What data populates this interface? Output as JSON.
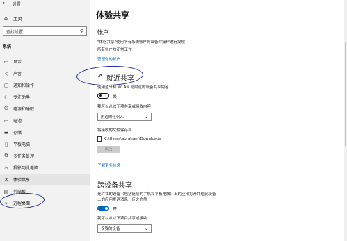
{
  "window": {
    "title": "设置",
    "back_icon": "back-arrow-icon"
  },
  "sidebar": {
    "home_label": "主页",
    "search_placeholder": "查找设置",
    "section_label": "系统",
    "items": [
      {
        "label": "显示",
        "icon": "display-icon"
      },
      {
        "label": "声音",
        "icon": "speaker-icon"
      },
      {
        "label": "通知和操作",
        "icon": "notification-icon"
      },
      {
        "label": "专注助手",
        "icon": "moon-icon"
      },
      {
        "label": "电源和睡眠",
        "icon": "power-icon"
      },
      {
        "label": "电池",
        "icon": "battery-icon"
      },
      {
        "label": "存储",
        "icon": "storage-icon"
      },
      {
        "label": "平板电脑",
        "icon": "tablet-icon"
      },
      {
        "label": "多任务处理",
        "icon": "multitask-icon"
      },
      {
        "label": "投影到此电脑",
        "icon": "project-icon"
      },
      {
        "label": "体验共享",
        "icon": "shared-experiences-icon",
        "active": true
      },
      {
        "label": "剪贴板",
        "icon": "clipboard-icon"
      },
      {
        "label": "远程桌面",
        "icon": "remote-desktop-icon"
      }
    ]
  },
  "main": {
    "title": "体验共享",
    "accounts": {
      "heading": "帐户",
      "desc1": "\"体验共享\"使用所有系统帐户将设备对操作进行授权",
      "desc2": "所有帐户均正常工作",
      "link": "管理你的帐户"
    },
    "nearby": {
      "heading": "就近共享",
      "desc": "使用蓝牙和 WLAN 与附近的设备共享内容",
      "toggle_state": "关",
      "receive_label": "我可以从以下项共享或接收内容",
      "receive_value": "附近的任何人",
      "save_label": "将接收的文件保存到",
      "save_path": "C:\\Users\\abraham\\Downloads",
      "change_button": "更改",
      "learn_more": "了解更多信息"
    },
    "cross_device": {
      "heading": "跨设备共享",
      "desc1": "允许我的设备（包括链接的手机和平板电脑）上的应用打开并给此设备",
      "desc2": "上的应用发送消息，反之亦然",
      "toggle_state": "开",
      "receive_label": "我可以从以下项目共享或接收",
      "receive_value": "仅我的设备"
    }
  },
  "colors": {
    "accent": "#0067c0",
    "annotation_ink": "#1c2da0",
    "sidebar_bg": "#f2f2f2"
  }
}
